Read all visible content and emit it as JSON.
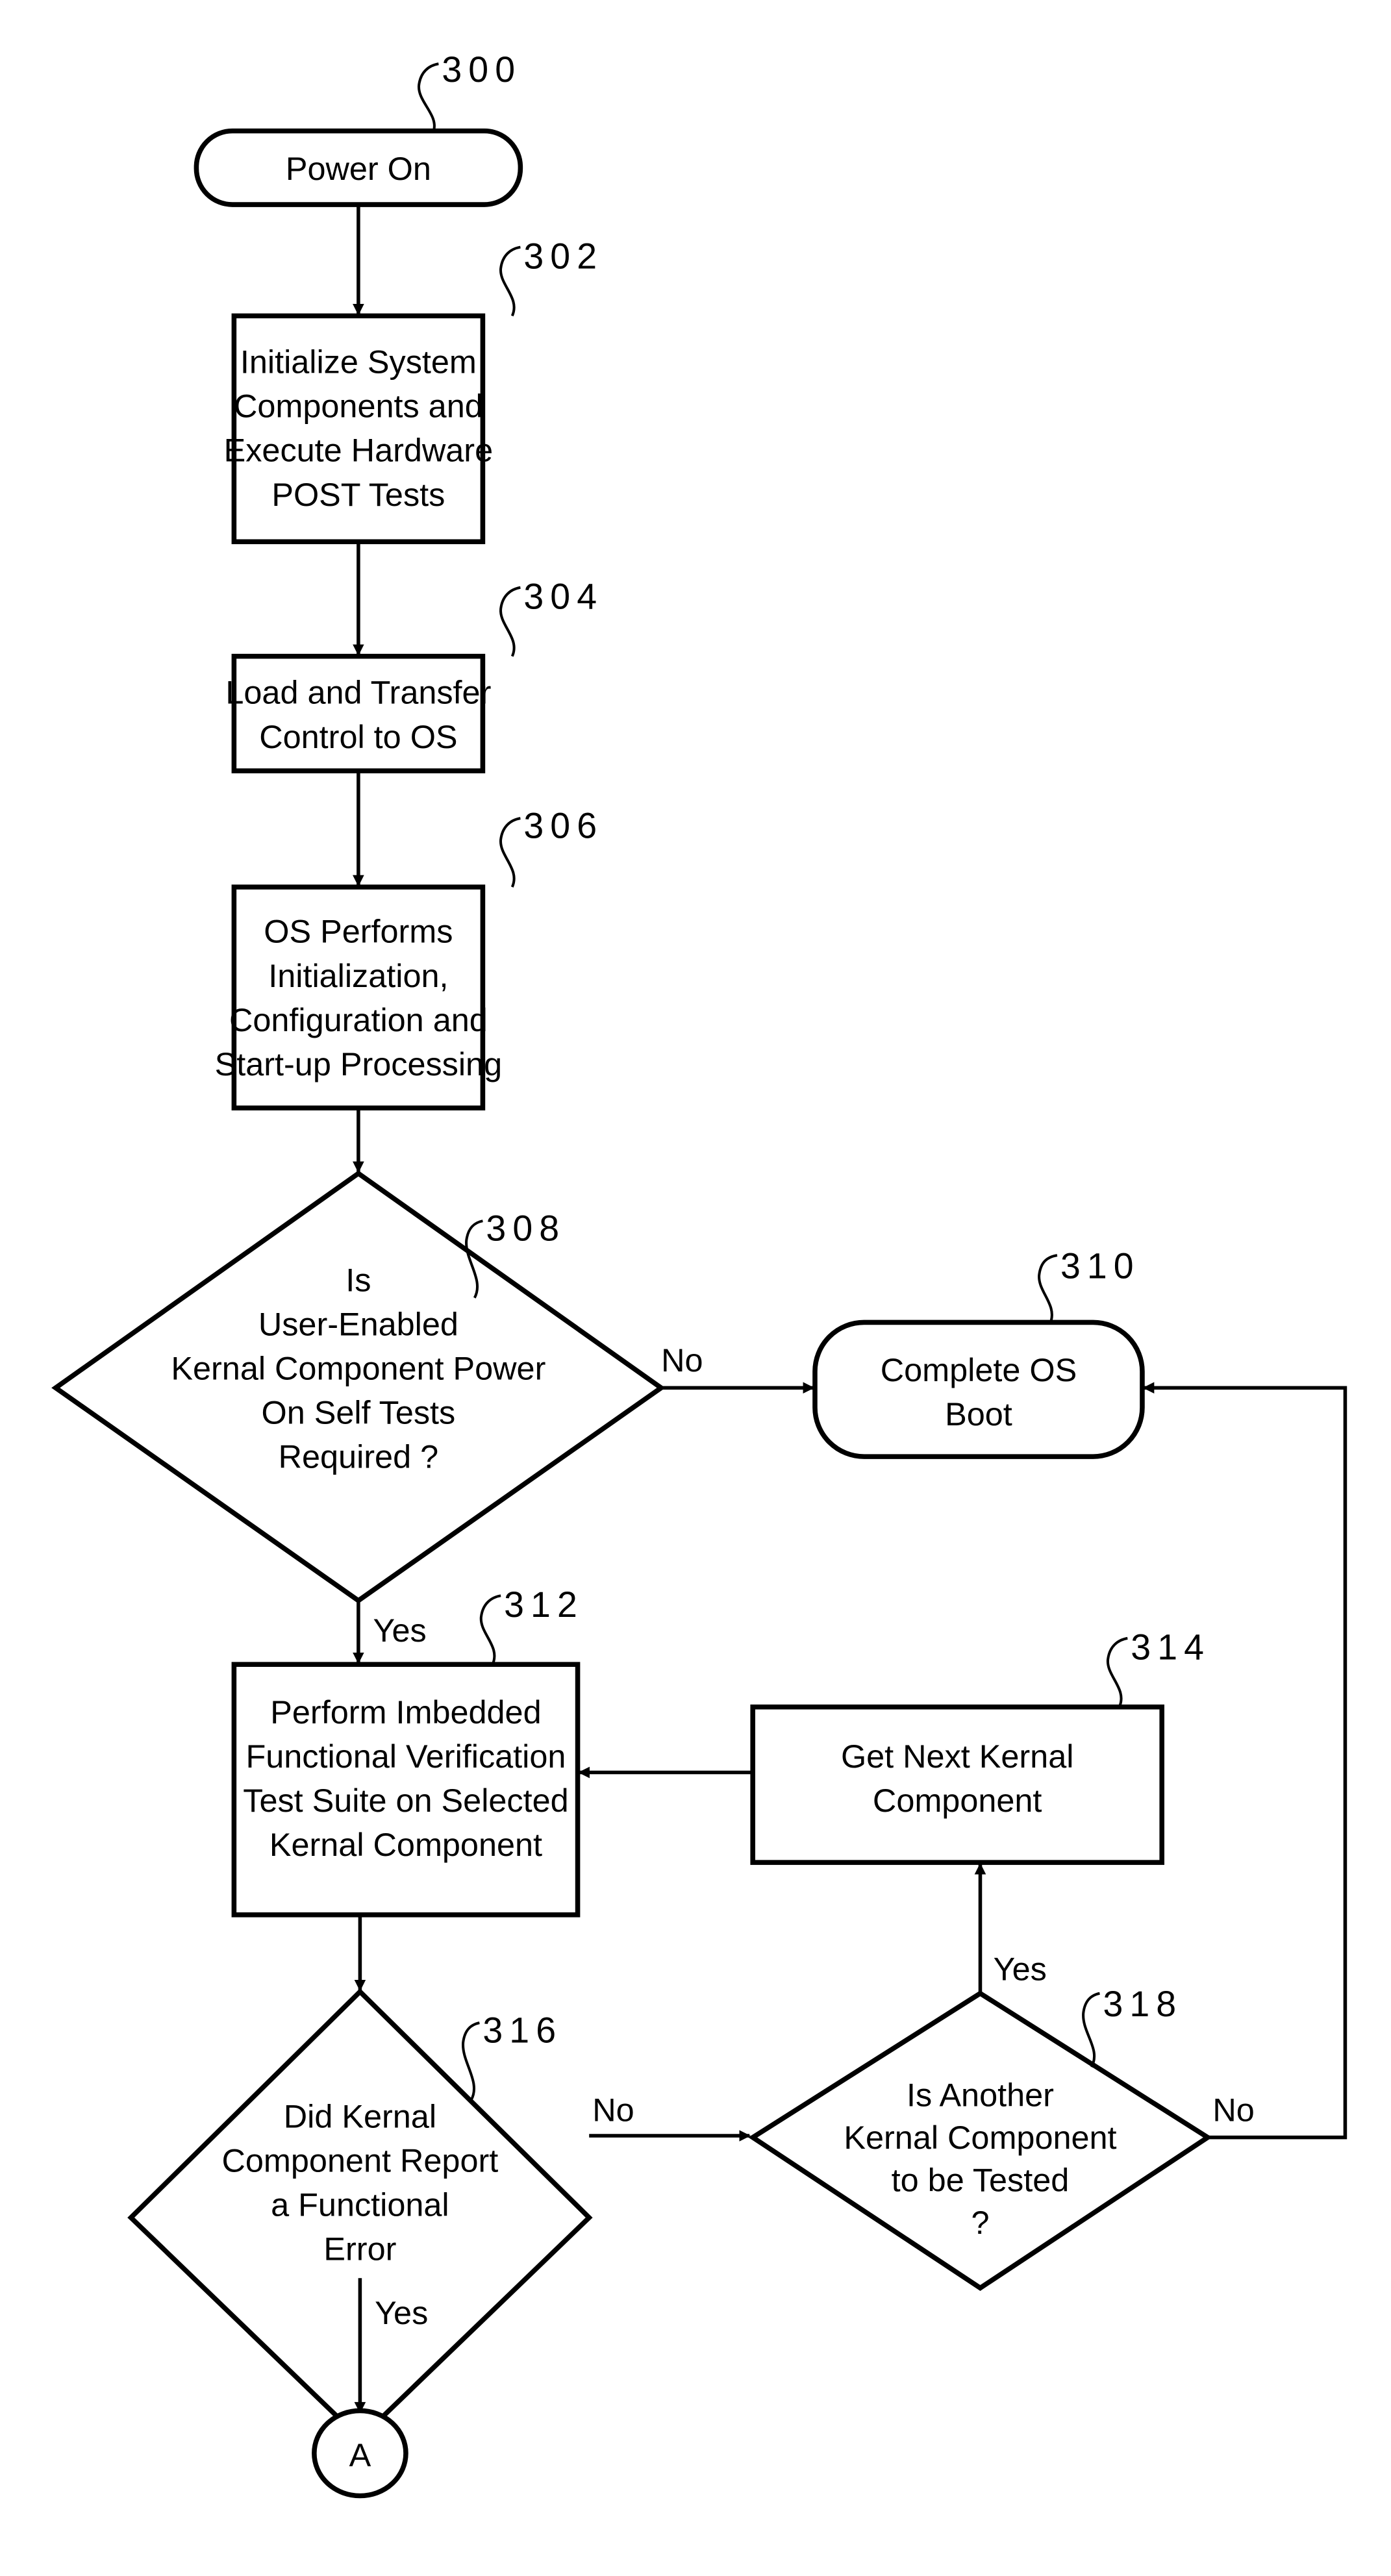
{
  "figure": {
    "nodes": {
      "n300": {
        "ref": "300",
        "type": "terminal",
        "lines": [
          "Power On"
        ]
      },
      "n302": {
        "ref": "302",
        "type": "process",
        "lines": [
          "Initialize System",
          "Components and",
          "Execute Hardware",
          "POST Tests"
        ]
      },
      "n304": {
        "ref": "304",
        "type": "process",
        "lines": [
          "Load and Transfer",
          "Control to OS"
        ]
      },
      "n306": {
        "ref": "306",
        "type": "process",
        "lines": [
          "OS Performs",
          "Initialization,",
          "Configuration and",
          "Start-up Processing"
        ]
      },
      "n308": {
        "ref": "308",
        "type": "decision",
        "lines": [
          "Is",
          "User-Enabled",
          "Kernal Component Power",
          "On Self Tests",
          "Required ?"
        ]
      },
      "n310": {
        "ref": "310",
        "type": "terminal",
        "lines": [
          "Complete OS",
          "Boot"
        ]
      },
      "n312": {
        "ref": "312",
        "type": "process",
        "lines": [
          "Perform Imbedded",
          "Functional Verification",
          "Test Suite on Selected",
          "Kernal Component"
        ]
      },
      "n314": {
        "ref": "314",
        "type": "process",
        "lines": [
          "Get Next Kernal",
          "Component"
        ]
      },
      "n316": {
        "ref": "316",
        "type": "decision",
        "lines": [
          "Did Kernal",
          "Component Report",
          "a Functional",
          "Error"
        ]
      },
      "n318": {
        "ref": "318",
        "type": "decision",
        "lines": [
          "Is Another",
          "Kernal Component",
          "to be Tested",
          "?"
        ]
      },
      "connA": {
        "type": "connector",
        "lines": [
          "A"
        ]
      }
    },
    "edges": [
      {
        "from": "300",
        "to": "302",
        "label": ""
      },
      {
        "from": "302",
        "to": "304",
        "label": ""
      },
      {
        "from": "304",
        "to": "306",
        "label": ""
      },
      {
        "from": "306",
        "to": "308",
        "label": ""
      },
      {
        "from": "308",
        "to": "310",
        "label": "No"
      },
      {
        "from": "308",
        "to": "312",
        "label": "Yes"
      },
      {
        "from": "312",
        "to": "316",
        "label": ""
      },
      {
        "from": "316",
        "to": "318",
        "label": "No"
      },
      {
        "from": "316",
        "to": "A",
        "label": "Yes"
      },
      {
        "from": "318",
        "to": "314",
        "label": "Yes"
      },
      {
        "from": "318",
        "to": "310",
        "label": "No"
      },
      {
        "from": "314",
        "to": "312",
        "label": ""
      }
    ],
    "edge_labels": {
      "e308_no": "No",
      "e308_yes": "Yes",
      "e316_no": "No",
      "e316_yes": "Yes",
      "e318_yes": "Yes",
      "e318_no": "No"
    }
  }
}
